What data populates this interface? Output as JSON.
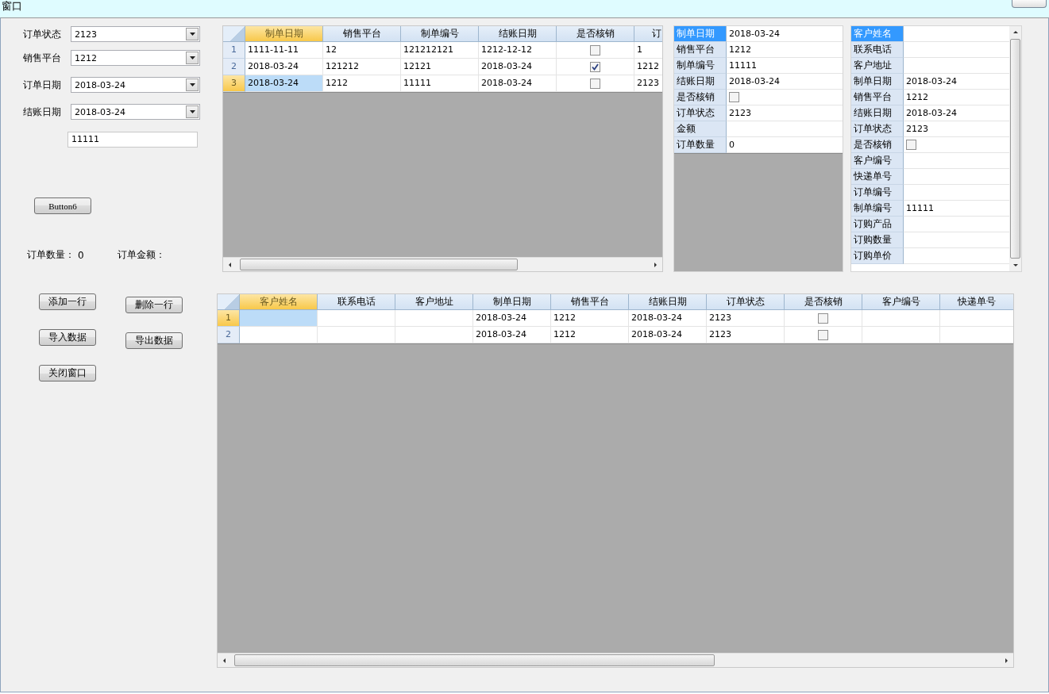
{
  "window": {
    "title": "窗口"
  },
  "filters": [
    {
      "label": "订单状态",
      "value": "2123"
    },
    {
      "label": "销售平台",
      "value": "1212"
    },
    {
      "label": "订单日期",
      "value": "2018-03-24"
    },
    {
      "label": "结账日期",
      "value": "2018-03-24"
    }
  ],
  "code_field": {
    "value": "11111"
  },
  "extra_button": "Button6",
  "summary": [
    {
      "label": "订单数量：",
      "value": "0"
    },
    {
      "label": "订单金额："
    }
  ],
  "action_buttons": [
    "添加一行",
    "删除一行",
    "导入数据",
    "导出数据",
    "关闭窗口"
  ],
  "orders_grid": {
    "columns": [
      {
        "label": "制单日期",
        "selected": true
      },
      {
        "label": "销售平台",
        "selected": false
      },
      {
        "label": "制单编号",
        "selected": false
      },
      {
        "label": "结账日期",
        "selected": false
      },
      {
        "label": "是否核销",
        "selected": false
      },
      {
        "label": "订",
        "selected": false
      }
    ],
    "rows": [
      {
        "number": "1",
        "selected": false,
        "cells": [
          {
            "kind": "text",
            "text": "1111-11-11",
            "selected": false
          },
          {
            "kind": "text",
            "text": "12",
            "selected": false
          },
          {
            "kind": "text",
            "text": "121212121",
            "selected": false
          },
          {
            "kind": "text",
            "text": "1212-12-12",
            "selected": false
          },
          {
            "kind": "check",
            "checked": false,
            "selected": false
          },
          {
            "kind": "text",
            "text": "1",
            "selected": false
          }
        ]
      },
      {
        "number": "2",
        "selected": false,
        "cells": [
          {
            "kind": "text",
            "text": "2018-03-24",
            "selected": false
          },
          {
            "kind": "text",
            "text": "121212",
            "selected": false
          },
          {
            "kind": "text",
            "text": "12121",
            "selected": false
          },
          {
            "kind": "text",
            "text": "2018-03-24",
            "selected": false
          },
          {
            "kind": "check",
            "checked": true,
            "selected": false
          },
          {
            "kind": "text",
            "text": "1212",
            "selected": false
          }
        ]
      },
      {
        "number": "3",
        "selected": true,
        "cells": [
          {
            "kind": "text",
            "text": "2018-03-24",
            "selected": true
          },
          {
            "kind": "text",
            "text": "1212",
            "selected": false
          },
          {
            "kind": "text",
            "text": "11111",
            "selected": false
          },
          {
            "kind": "text",
            "text": "2018-03-24",
            "selected": false
          },
          {
            "kind": "check",
            "checked": false,
            "selected": false
          },
          {
            "kind": "text",
            "text": "2123",
            "selected": false
          }
        ]
      }
    ]
  },
  "order_details": [
    {
      "label": "制单日期",
      "selected": true,
      "kind": "text",
      "value": "2018-03-24"
    },
    {
      "label": "销售平台",
      "selected": false,
      "kind": "text",
      "value": "1212"
    },
    {
      "label": "制单编号",
      "selected": false,
      "kind": "text",
      "value": "11111"
    },
    {
      "label": "结账日期",
      "selected": false,
      "kind": "text",
      "value": "2018-03-24"
    },
    {
      "label": "是否核销",
      "selected": false,
      "kind": "check",
      "checked": false
    },
    {
      "label": "订单状态",
      "selected": false,
      "kind": "text",
      "value": "2123"
    },
    {
      "label": "金额",
      "selected": false,
      "kind": "blank"
    },
    {
      "label": "订单数量",
      "selected": false,
      "kind": "text",
      "value": "0"
    }
  ],
  "customer_details": [
    {
      "label": "客户姓名",
      "selected": true,
      "kind": "blank"
    },
    {
      "label": "联系电话",
      "selected": false,
      "kind": "blank"
    },
    {
      "label": "客户地址",
      "selected": false,
      "kind": "blank"
    },
    {
      "label": "制单日期",
      "selected": false,
      "kind": "text",
      "value": "2018-03-24"
    },
    {
      "label": "销售平台",
      "selected": false,
      "kind": "text",
      "value": "1212"
    },
    {
      "label": "结账日期",
      "selected": false,
      "kind": "text",
      "value": "2018-03-24"
    },
    {
      "label": "订单状态",
      "selected": false,
      "kind": "text",
      "value": "2123"
    },
    {
      "label": "是否核销",
      "selected": false,
      "kind": "check",
      "checked": false
    },
    {
      "label": "客户编号",
      "selected": false,
      "kind": "blank"
    },
    {
      "label": "快递单号",
      "selected": false,
      "kind": "blank"
    },
    {
      "label": "订单编号",
      "selected": false,
      "kind": "blank"
    },
    {
      "label": "制单编号",
      "selected": false,
      "kind": "text",
      "value": "11111"
    },
    {
      "label": "订购产品",
      "selected": false,
      "kind": "blank"
    },
    {
      "label": "订购数量",
      "selected": false,
      "kind": "blank"
    },
    {
      "label": "订购单价",
      "selected": false,
      "kind": "blank"
    }
  ],
  "items_grid": {
    "columns": [
      {
        "label": "客户姓名",
        "selected": true
      },
      {
        "label": "联系电话",
        "selected": false
      },
      {
        "label": "客户地址",
        "selected": false
      },
      {
        "label": "制单日期",
        "selected": false
      },
      {
        "label": "销售平台",
        "selected": false
      },
      {
        "label": "结账日期",
        "selected": false
      },
      {
        "label": "订单状态",
        "selected": false
      },
      {
        "label": "是否核销",
        "selected": false
      },
      {
        "label": "客户编号",
        "selected": false
      },
      {
        "label": "快递单号",
        "selected": false
      }
    ],
    "rows": [
      {
        "number": "1",
        "selected": true,
        "cells": [
          {
            "kind": "blank",
            "selected": true
          },
          {
            "kind": "blank",
            "selected": false
          },
          {
            "kind": "blank",
            "selected": false
          },
          {
            "kind": "text",
            "text": "2018-03-24",
            "selected": false
          },
          {
            "kind": "text",
            "text": "1212",
            "selected": false
          },
          {
            "kind": "text",
            "text": "2018-03-24",
            "selected": false
          },
          {
            "kind": "text",
            "text": "2123",
            "selected": false
          },
          {
            "kind": "check",
            "checked": false,
            "selected": false
          },
          {
            "kind": "blank",
            "selected": false
          },
          {
            "kind": "blank",
            "selected": false
          }
        ]
      },
      {
        "number": "2",
        "selected": false,
        "cells": [
          {
            "kind": "blank",
            "selected": false
          },
          {
            "kind": "blank",
            "selected": false
          },
          {
            "kind": "blank",
            "selected": false
          },
          {
            "kind": "text",
            "text": "2018-03-24",
            "selected": false
          },
          {
            "kind": "text",
            "text": "1212",
            "selected": false
          },
          {
            "kind": "text",
            "text": "2018-03-24",
            "selected": false
          },
          {
            "kind": "text",
            "text": "2123",
            "selected": false
          },
          {
            "kind": "check",
            "checked": false,
            "selected": false
          },
          {
            "kind": "blank",
            "selected": false
          },
          {
            "kind": "blank",
            "selected": false
          }
        ]
      }
    ]
  }
}
